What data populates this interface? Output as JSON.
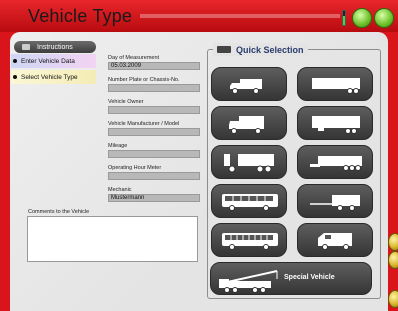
{
  "window": {
    "title": "Vehicle Type"
  },
  "instructions": {
    "button_label": "Instructions",
    "steps": [
      "Enter Vehicle Data",
      "Select Vehicle Type"
    ]
  },
  "form": {
    "day_label": "Day of Measurement",
    "day_value": "05.03.2009",
    "plate_label": "Number Plate or Chassis-No.",
    "plate_value": "",
    "owner_label": "Vehicle Owner",
    "owner_value": "",
    "manufacturer_label": "Vehicle Manufacturer / Model",
    "manufacturer_value": "",
    "mileage_label": "Mileage",
    "mileage_value": "",
    "hour_label": "Operating Hour Meter",
    "hour_value": "",
    "mechanic_label": "Mechanic",
    "mechanic_value": "Mustermann"
  },
  "comments": {
    "label": "Comments to the Vehicle",
    "value": ""
  },
  "quick_selection": {
    "title": "Quick Selection",
    "special_label": "Special Vehicle",
    "vehicles": [
      "small-truck-icon",
      "semitrailer-icon",
      "box-truck-icon",
      "long-trailer-icon",
      "three-axle-truck-icon",
      "low-loader-icon",
      "coach-bus-icon",
      "drawbar-trailer-icon",
      "city-bus-icon",
      "van-icon"
    ]
  },
  "colors": {
    "frame_red": "#d9141a",
    "button_green": "#6bbf28",
    "button_dark": "#3d3d3d"
  }
}
